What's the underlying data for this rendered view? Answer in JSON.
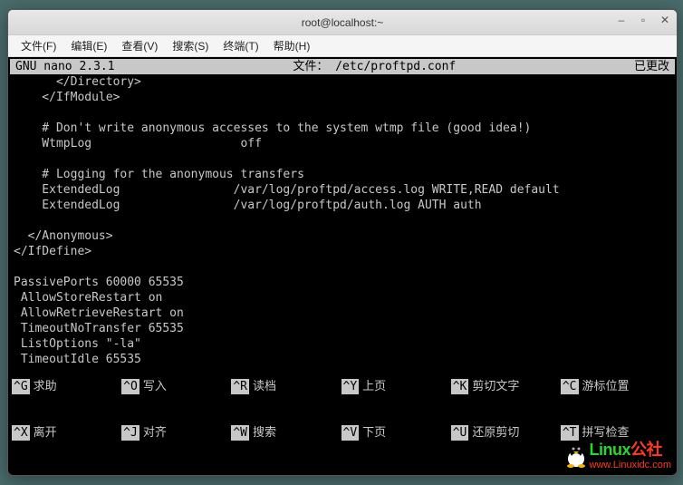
{
  "window": {
    "title": "root@localhost:~"
  },
  "menubar": {
    "items": [
      "文件(F)",
      "编辑(E)",
      "查看(V)",
      "搜索(S)",
      "终端(T)",
      "帮助(H)"
    ]
  },
  "nano": {
    "header": {
      "app": "GNU nano 2.3.1",
      "file_label": "文件：",
      "file_path": "/etc/proftpd.conf",
      "status": "已更改"
    },
    "lines": [
      "      </Directory>",
      "    </IfModule>",
      "",
      "    # Don't write anonymous accesses to the system wtmp file (good idea!)",
      "    WtmpLog                     off",
      "",
      "    # Logging for the anonymous transfers",
      "    ExtendedLog                /var/log/proftpd/access.log WRITE,READ default",
      "    ExtendedLog                /var/log/proftpd/auth.log AUTH auth",
      "",
      "  </Anonymous>",
      "</IfDefine>",
      "",
      "PassivePorts 60000 65535",
      " AllowStoreRestart on",
      " AllowRetrieveRestart on",
      " TimeoutNoTransfer 65535",
      " ListOptions \"-la\"",
      " TimeoutIdle 65535"
    ],
    "shortcuts": {
      "row1": [
        {
          "key": "^G",
          "label": "求助"
        },
        {
          "key": "^O",
          "label": "写入"
        },
        {
          "key": "^R",
          "label": "读档"
        },
        {
          "key": "^Y",
          "label": "上页"
        },
        {
          "key": "^K",
          "label": "剪切文字"
        },
        {
          "key": "^C",
          "label": "游标位置"
        }
      ],
      "row2": [
        {
          "key": "^X",
          "label": "离开"
        },
        {
          "key": "^J",
          "label": "对齐"
        },
        {
          "key": "^W",
          "label": "搜索"
        },
        {
          "key": "^V",
          "label": "下页"
        },
        {
          "key": "^U",
          "label": "还原剪切"
        },
        {
          "key": "^T",
          "label": "拼写检查"
        }
      ]
    }
  },
  "watermark": {
    "brand_a": "Linux",
    "brand_b": "公社",
    "url": "www.Linuxidc.com"
  }
}
